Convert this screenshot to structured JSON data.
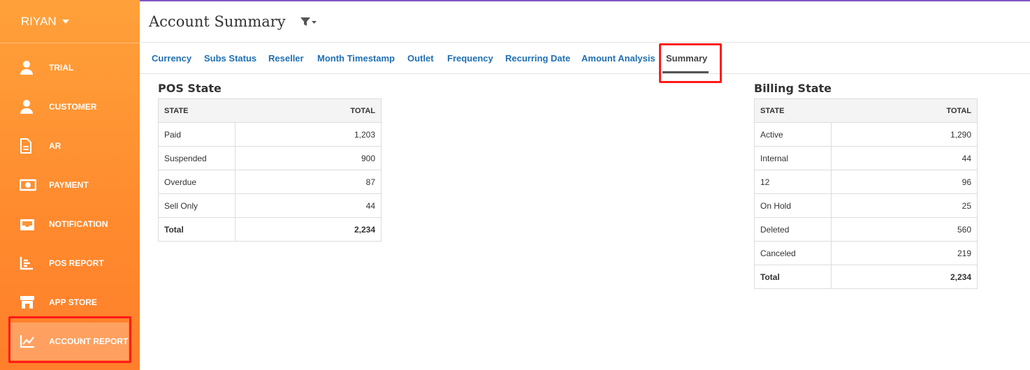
{
  "sidebar": {
    "user": "RIYAN",
    "items": [
      {
        "label": "TRIAL",
        "icon": "person-icon"
      },
      {
        "label": "CUSTOMER",
        "icon": "person-icon"
      },
      {
        "label": "AR",
        "icon": "document-icon"
      },
      {
        "label": "PAYMENT",
        "icon": "money-icon"
      },
      {
        "label": "NOTIFICATION",
        "icon": "inbox-icon"
      },
      {
        "label": "POS REPORT",
        "icon": "bar-chart-icon"
      },
      {
        "label": "APP STORE",
        "icon": "store-icon"
      },
      {
        "label": "ACCOUNT REPORT",
        "icon": "line-chart-icon",
        "active": true
      }
    ]
  },
  "header": {
    "title": "Account Summary",
    "filter_icon": "filter-icon"
  },
  "tabs": [
    {
      "label": "Currency"
    },
    {
      "label": "Subs Status"
    },
    {
      "label": "Reseller"
    },
    {
      "label": "Month Timestamp"
    },
    {
      "label": "Outlet"
    },
    {
      "label": "Frequency"
    },
    {
      "label": "Recurring Date"
    },
    {
      "label": "Amount Analysis"
    },
    {
      "label": "Summary",
      "active": true
    }
  ],
  "pos_state": {
    "title": "POS State",
    "col_state": "STATE",
    "col_total": "TOTAL",
    "rows": [
      {
        "state": "Paid",
        "total": "1,203"
      },
      {
        "state": "Suspended",
        "total": "900"
      },
      {
        "state": "Overdue",
        "total": "87"
      },
      {
        "state": "Sell Only",
        "total": "44"
      }
    ],
    "total_label": "Total",
    "total_value": "2,234"
  },
  "billing_state": {
    "title": "Billing State",
    "col_state": "STATE",
    "col_total": "TOTAL",
    "rows": [
      {
        "state": "Active",
        "total": "1,290"
      },
      {
        "state": "Internal",
        "total": "44"
      },
      {
        "state": "12",
        "total": "96"
      },
      {
        "state": "On Hold",
        "total": "25"
      },
      {
        "state": "Deleted",
        "total": "560"
      },
      {
        "state": "Canceled",
        "total": "219"
      }
    ],
    "total_label": "Total",
    "total_value": "2,234"
  },
  "colors": {
    "sidebar_top": "#ffa13a",
    "sidebar_bottom": "#ff7f2a",
    "tab_link": "#1f6fb2",
    "highlight": "#ff1a1a"
  }
}
